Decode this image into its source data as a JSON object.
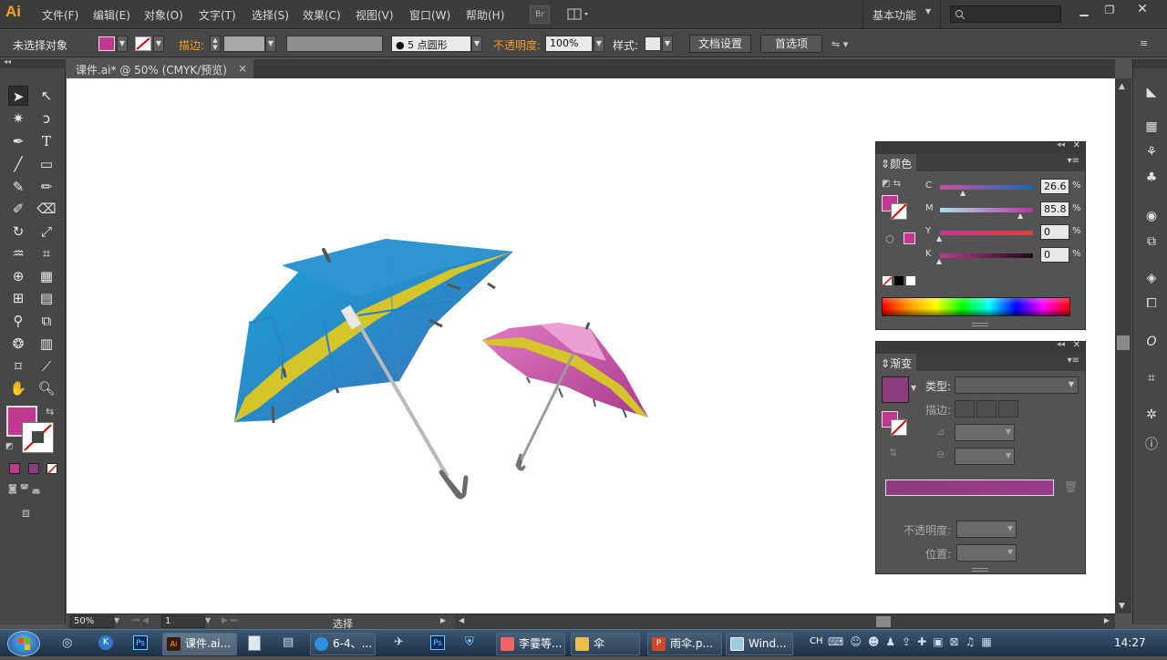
{
  "app": {
    "logo": "Ai"
  },
  "menus": [
    "文件(F)",
    "编辑(E)",
    "对象(O)",
    "文字(T)",
    "选择(S)",
    "效果(C)",
    "视图(V)",
    "窗口(W)",
    "帮助(H)"
  ],
  "menubar": {
    "bridge_label": "Br",
    "workspace": "基本功能",
    "search_placeholder": ""
  },
  "control": {
    "selection": "未选择对象",
    "stroke_label": "描边:",
    "brush_value": "5 点圆形",
    "opacity_label": "不透明度:",
    "opacity_value": "100%",
    "style_label": "样式:",
    "doc_setup": "文档设置",
    "prefs": "首选项"
  },
  "document": {
    "tab_title": "课件.ai* @ 50% (CMYK/预览)"
  },
  "color_panel": {
    "title": "颜色",
    "channels": [
      {
        "label": "C",
        "value": "26.6"
      },
      {
        "label": "M",
        "value": "85.8"
      },
      {
        "label": "Y",
        "value": "0"
      },
      {
        "label": "K",
        "value": "0"
      }
    ],
    "percent": "%"
  },
  "gradient_panel": {
    "title": "渐变",
    "type_label": "类型:",
    "stroke_label": "描边:",
    "opacity_label": "不透明度:",
    "position_label": "位置:"
  },
  "statusbar": {
    "zoom": "50%",
    "page": "1",
    "status": "选择"
  },
  "taskbar": {
    "items": [
      "课件.ai...",
      "6-4、...",
      "李霎等...",
      "伞",
      "雨伞.p...",
      "Wind..."
    ],
    "lang": "CH",
    "clock": "14:27"
  },
  "colors": {
    "fill": "#c0388f",
    "accent_orange": "#f39a29",
    "umbrella_blue": "#2f8fcf",
    "umbrella_pink": "#c75aa8",
    "stripe_yellow": "#d6c52a"
  }
}
